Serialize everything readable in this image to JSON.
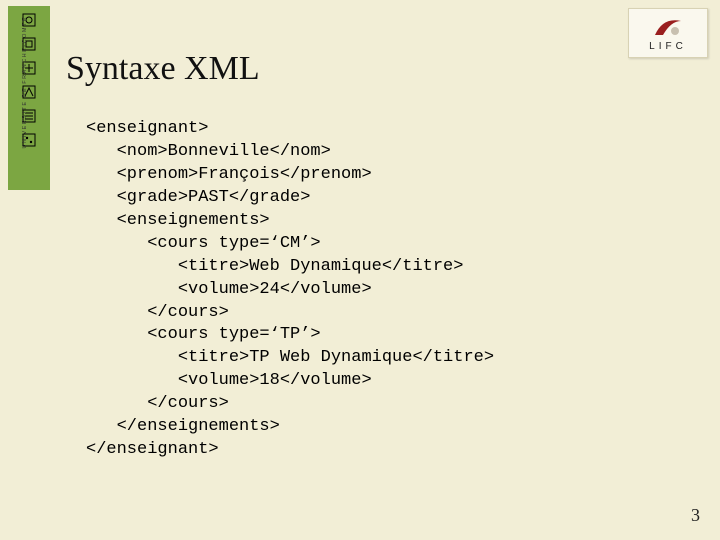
{
  "sidebar": {
    "label": "UNIVERSITE DE FRANCHE-COMTE"
  },
  "logo": {
    "text": "LIFC"
  },
  "title": "Syntaxe XML",
  "code": "<enseignant>\n   <nom>Bonneville</nom>\n   <prenom>François</prenom>\n   <grade>PAST</grade>\n   <enseignements>\n      <cours type=‘CM’>\n         <titre>Web Dynamique</titre>\n         <volume>24</volume>\n      </cours>\n      <cours type=‘TP’>\n         <titre>TP Web Dynamique</titre>\n         <volume>18</volume>\n      </cours>\n   </enseignements>\n</enseignant>",
  "page_number": "3"
}
